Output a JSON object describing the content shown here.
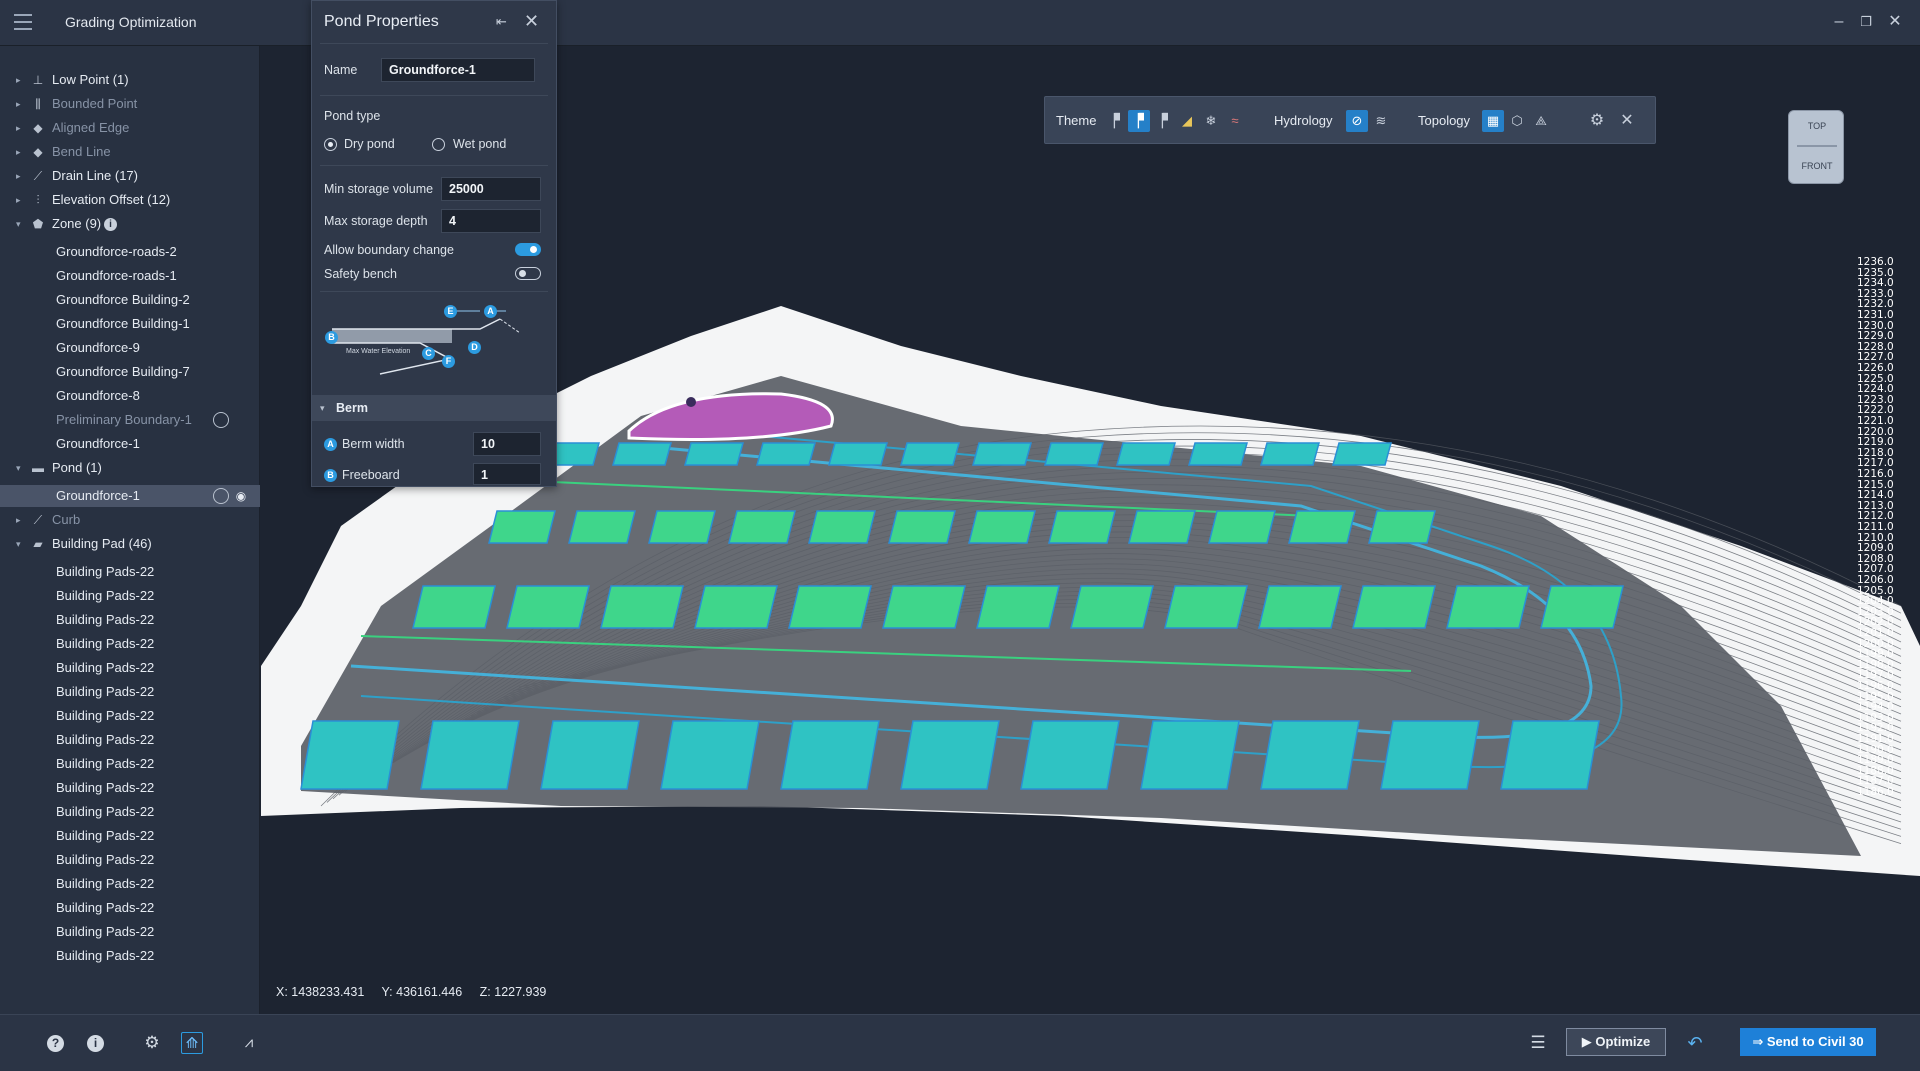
{
  "app": {
    "title": "Grading Optimization"
  },
  "window_controls": {
    "minimize": "–",
    "restore": "❐",
    "close": "✕"
  },
  "sidebar": {
    "items": [
      {
        "label": "Low Point (1)",
        "icon": "low-point-icon",
        "caret": "▸",
        "dim": false
      },
      {
        "label": "Bounded Point",
        "icon": "bounded-point-icon",
        "caret": "▸",
        "dim": true
      },
      {
        "label": "Aligned Edge",
        "icon": "aligned-edge-icon",
        "caret": "▸",
        "dim": true
      },
      {
        "label": "Bend Line",
        "icon": "bend-line-icon",
        "caret": "▸",
        "dim": true
      },
      {
        "label": "Drain Line (17)",
        "icon": "drain-line-icon",
        "caret": "▸",
        "dim": false
      },
      {
        "label": "Elevation Offset (12)",
        "icon": "elevation-offset-icon",
        "caret": "▸",
        "dim": false
      },
      {
        "label": "Zone (9)",
        "icon": "zone-icon",
        "caret": "▾",
        "dim": false
      },
      {
        "label": "Groundforce-roads-2",
        "child": true
      },
      {
        "label": "Groundforce-roads-1",
        "child": true
      },
      {
        "label": "Groundforce Building-2",
        "child": true
      },
      {
        "label": "Groundforce Building-1",
        "child": true
      },
      {
        "label": "Groundforce-9",
        "child": true
      },
      {
        "label": "Groundforce Building-7",
        "child": true
      },
      {
        "label": "Groundforce-8",
        "child": true
      },
      {
        "label": "Preliminary Boundary-1",
        "child": true,
        "dim": true
      },
      {
        "label": "Groundforce-1",
        "child": true
      },
      {
        "label": "Pond (1)",
        "icon": "pond-icon",
        "caret": "▾",
        "dim": false
      },
      {
        "label": "Groundforce-1",
        "child": true,
        "selected": true
      },
      {
        "label": "Curb",
        "icon": "curb-icon",
        "caret": "▸",
        "dim": true
      },
      {
        "label": "Building Pad (46)",
        "icon": "building-pad-icon",
        "caret": "▾",
        "dim": false
      },
      {
        "label": "Building Pads-22",
        "child": true
      },
      {
        "label": "Building Pads-22",
        "child": true
      },
      {
        "label": "Building Pads-22",
        "child": true
      },
      {
        "label": "Building Pads-22",
        "child": true
      },
      {
        "label": "Building Pads-22",
        "child": true
      },
      {
        "label": "Building Pads-22",
        "child": true
      },
      {
        "label": "Building Pads-22",
        "child": true
      },
      {
        "label": "Building Pads-22",
        "child": true
      },
      {
        "label": "Building Pads-22",
        "child": true
      },
      {
        "label": "Building Pads-22",
        "child": true
      },
      {
        "label": "Building Pads-22",
        "child": true
      },
      {
        "label": "Building Pads-22",
        "child": true
      },
      {
        "label": "Building Pads-22",
        "child": true
      },
      {
        "label": "Building Pads-22",
        "child": true
      },
      {
        "label": "Building Pads-22",
        "child": true
      },
      {
        "label": "Building Pads-22",
        "child": true
      },
      {
        "label": "Building Pads-22",
        "child": true
      }
    ],
    "zone_info": "i",
    "collapse": "‹"
  },
  "pond_panel": {
    "title": "Pond Properties",
    "name_label": "Name",
    "name_value": "Groundforce-1",
    "pond_type_label": "Pond type",
    "dry_pond": "Dry pond",
    "wet_pond": "Wet pond",
    "selected_type": "Dry pond",
    "min_storage_label": "Min storage volume",
    "min_storage_value": "25000",
    "max_depth_label": "Max storage depth",
    "max_depth_value": "4",
    "allow_boundary_label": "Allow boundary change",
    "allow_boundary_on": true,
    "safety_bench_label": "Safety bench",
    "safety_bench_on": false,
    "diagram_caption": "Max Water Elevation",
    "diagram_badges": [
      "A",
      "B",
      "C",
      "D",
      "E",
      "F"
    ],
    "berm_header": "Berm",
    "berm_width_label": "Berm width",
    "berm_width_badge": "A",
    "berm_width_value": "10",
    "freeboard_label": "Freeboard",
    "freeboard_badge": "B",
    "freeboard_value": "1"
  },
  "toolbar": {
    "theme_label": "Theme",
    "hydrology_label": "Hydrology",
    "topology_label": "Topology"
  },
  "viewcube": {
    "top": "TOP",
    "front": "FRONT"
  },
  "coords": {
    "x": "X: 1438233.431",
    "y": "Y: 436161.446",
    "z": "Z: 1227.939"
  },
  "elevation_scale": [
    "1236.0",
    "1235.0",
    "1234.0",
    "1233.0",
    "1232.0",
    "1231.0",
    "1230.0",
    "1229.0",
    "1228.0",
    "1227.0",
    "1226.0",
    "1225.0",
    "1224.0",
    "1223.0",
    "1222.0",
    "1221.0",
    "1220.0",
    "1219.0",
    "1218.0",
    "1217.0",
    "1216.0",
    "1215.0",
    "1214.0",
    "1213.0",
    "1212.0",
    "1211.0",
    "1210.0",
    "1209.0",
    "1208.0",
    "1207.0",
    "1206.0",
    "1205.0",
    "1204.0",
    "1203.0",
    "1202.0",
    "1201.0",
    "1200.0",
    "1199.0",
    "1198.0",
    "1197.0",
    "1196.0",
    "1195.0",
    "1194.0",
    "1193.0",
    "1192.0",
    "1191.0",
    "1190.0",
    "1189.0",
    "1188.0",
    "1187.0",
    "1186.0"
  ],
  "bottombar": {
    "optimize_label": "Optimize",
    "send_label": "Send to Civil 30"
  },
  "colors": {
    "pad_green": "#3fd68b",
    "pad_cyan": "#2fc3c3",
    "road": "#5a5e66",
    "pond_magenta": "#c065c8",
    "terrain": "#f4f5f6",
    "accent": "#1e80d8"
  }
}
